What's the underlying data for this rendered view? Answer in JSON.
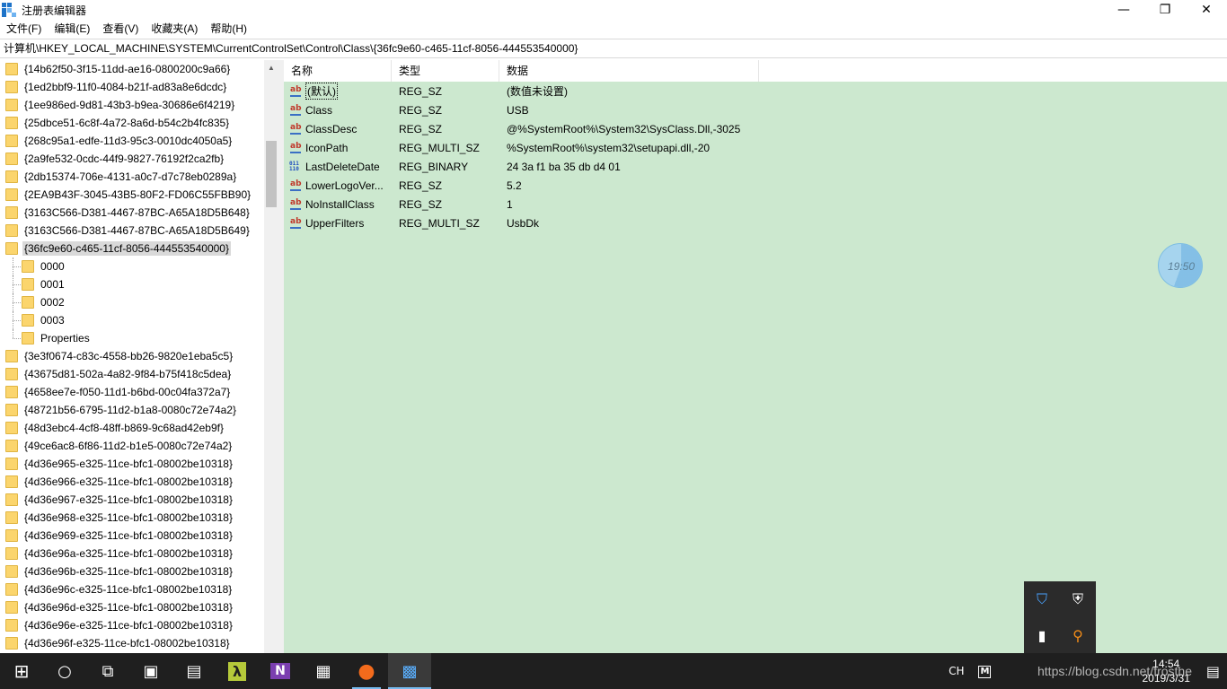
{
  "window": {
    "title": "注册表编辑器",
    "minimize_glyph": "—",
    "maximize_glyph": "❐",
    "close_glyph": "✕"
  },
  "menu": [
    "文件(F)",
    "编辑(E)",
    "查看(V)",
    "收藏夹(A)",
    "帮助(H)"
  ],
  "address": "计算机\\HKEY_LOCAL_MACHINE\\SYSTEM\\CurrentControlSet\\Control\\Class\\{36fc9e60-c465-11cf-8056-444553540000}",
  "tree": [
    {
      "label": "{14b62f50-3f15-11dd-ae16-0800200c9a66}",
      "level": 0
    },
    {
      "label": "{1ed2bbf9-11f0-4084-b21f-ad83a8e6dcdc}",
      "level": 0
    },
    {
      "label": "{1ee986ed-9d81-43b3-b9ea-30686e6f4219}",
      "level": 0
    },
    {
      "label": "{25dbce51-6c8f-4a72-8a6d-b54c2b4fc835}",
      "level": 0
    },
    {
      "label": "{268c95a1-edfe-11d3-95c3-0010dc4050a5}",
      "level": 0
    },
    {
      "label": "{2a9fe532-0cdc-44f9-9827-76192f2ca2fb}",
      "level": 0
    },
    {
      "label": "{2db15374-706e-4131-a0c7-d7c78eb0289a}",
      "level": 0
    },
    {
      "label": "{2EA9B43F-3045-43B5-80F2-FD06C55FBB90}",
      "level": 0
    },
    {
      "label": "{3163C566-D381-4467-87BC-A65A18D5B648}",
      "level": 0
    },
    {
      "label": "{3163C566-D381-4467-87BC-A65A18D5B649}",
      "level": 0
    },
    {
      "label": "{36fc9e60-c465-11cf-8056-444553540000}",
      "level": 0,
      "selected": true
    },
    {
      "label": "0000",
      "level": 1
    },
    {
      "label": "0001",
      "level": 1
    },
    {
      "label": "0002",
      "level": 1
    },
    {
      "label": "0003",
      "level": 1
    },
    {
      "label": "Properties",
      "level": 1,
      "last": true
    },
    {
      "label": "{3e3f0674-c83c-4558-bb26-9820e1eba5c5}",
      "level": 0
    },
    {
      "label": "{43675d81-502a-4a82-9f84-b75f418c5dea}",
      "level": 0
    },
    {
      "label": "{4658ee7e-f050-11d1-b6bd-00c04fa372a7}",
      "level": 0
    },
    {
      "label": "{48721b56-6795-11d2-b1a8-0080c72e74a2}",
      "level": 0
    },
    {
      "label": "{48d3ebc4-4cf8-48ff-b869-9c68ad42eb9f}",
      "level": 0
    },
    {
      "label": "{49ce6ac8-6f86-11d2-b1e5-0080c72e74a2}",
      "level": 0
    },
    {
      "label": "{4d36e965-e325-11ce-bfc1-08002be10318}",
      "level": 0
    },
    {
      "label": "{4d36e966-e325-11ce-bfc1-08002be10318}",
      "level": 0
    },
    {
      "label": "{4d36e967-e325-11ce-bfc1-08002be10318}",
      "level": 0
    },
    {
      "label": "{4d36e968-e325-11ce-bfc1-08002be10318}",
      "level": 0
    },
    {
      "label": "{4d36e969-e325-11ce-bfc1-08002be10318}",
      "level": 0
    },
    {
      "label": "{4d36e96a-e325-11ce-bfc1-08002be10318}",
      "level": 0
    },
    {
      "label": "{4d36e96b-e325-11ce-bfc1-08002be10318}",
      "level": 0
    },
    {
      "label": "{4d36e96c-e325-11ce-bfc1-08002be10318}",
      "level": 0
    },
    {
      "label": "{4d36e96d-e325-11ce-bfc1-08002be10318}",
      "level": 0
    },
    {
      "label": "{4d36e96e-e325-11ce-bfc1-08002be10318}",
      "level": 0
    },
    {
      "label": "{4d36e96f-e325-11ce-bfc1-08002be10318}",
      "level": 0
    }
  ],
  "values_pane": {
    "columns": {
      "name": "名称",
      "type": "类型",
      "data": "数据"
    },
    "rows": [
      {
        "name": "(默认)",
        "type": "REG_SZ",
        "data": "(数值未设置)",
        "icon": "string-value-icon",
        "kind": "sz",
        "focused": true
      },
      {
        "name": "Class",
        "type": "REG_SZ",
        "data": "USB",
        "icon": "string-value-icon",
        "kind": "sz"
      },
      {
        "name": "ClassDesc",
        "type": "REG_SZ",
        "data": "@%SystemRoot%\\System32\\SysClass.Dll,-3025",
        "icon": "string-value-icon",
        "kind": "sz"
      },
      {
        "name": "IconPath",
        "type": "REG_MULTI_SZ",
        "data": "%SystemRoot%\\system32\\setupapi.dll,-20",
        "icon": "string-value-icon",
        "kind": "sz"
      },
      {
        "name": "LastDeleteDate",
        "type": "REG_BINARY",
        "data": "24 3a f1 ba 35 db d4 01",
        "icon": "binary-value-icon",
        "kind": "bin"
      },
      {
        "name": "LowerLogoVer...",
        "type": "REG_SZ",
        "data": "5.2",
        "icon": "string-value-icon",
        "kind": "sz"
      },
      {
        "name": "NoInstallClass",
        "type": "REG_SZ",
        "data": "1",
        "icon": "string-value-icon",
        "kind": "sz"
      },
      {
        "name": "UpperFilters",
        "type": "REG_MULTI_SZ",
        "data": "UsbDk",
        "icon": "string-value-icon",
        "kind": "sz"
      }
    ],
    "background": "#cce8cf"
  },
  "clock_gadget": {
    "time": "19:50"
  },
  "taskbar": {
    "apps": [
      {
        "name": "start-button",
        "glyph": "⊞"
      },
      {
        "name": "cortana-button",
        "glyph": "○"
      },
      {
        "name": "task-view-button",
        "glyph": "⧉"
      },
      {
        "name": "app-monitor-icon",
        "glyph": "▣"
      },
      {
        "name": "app-control-panel-icon",
        "glyph": "▤"
      },
      {
        "name": "app-lambda-icon",
        "glyph": "λ"
      },
      {
        "name": "app-onenote-icon",
        "glyph": "N"
      },
      {
        "name": "app-devices-icon",
        "glyph": "▦"
      },
      {
        "name": "app-firefox-icon",
        "glyph": "●"
      },
      {
        "name": "app-regedit-icon",
        "glyph": "▩"
      }
    ],
    "ime_lang": "CH",
    "ime_mode": "M",
    "time": "14:54",
    "date": "2019/3/31",
    "notification_glyph": "▤"
  },
  "tray_popup": {
    "items": [
      {
        "name": "shield-tray-icon",
        "glyph": "⛉",
        "color": "#4aa3ff"
      },
      {
        "name": "defender-tray-icon",
        "glyph": "⛨",
        "color": "#ffffff"
      },
      {
        "name": "bookmark-tray-icon",
        "glyph": "▮",
        "color": "#ffffff"
      },
      {
        "name": "search-tray-icon",
        "glyph": "⚲",
        "color": "#f28c18"
      }
    ]
  },
  "watermark": "https://blog.csdn.net/frosthe",
  "colors": {
    "folder": "#fbd56d",
    "selection": "#d9d9d9",
    "taskbar": "#1f1f1f",
    "accent": "#76b9ed"
  }
}
